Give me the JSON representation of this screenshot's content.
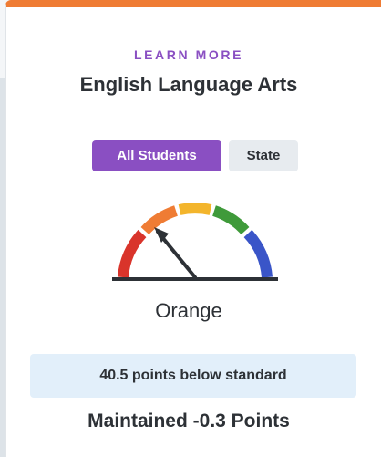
{
  "header": {
    "kicker": "LEARN MORE",
    "title": "English Language Arts"
  },
  "toggles": [
    {
      "label": "All Students",
      "selected": true
    },
    {
      "label": "State",
      "selected": false
    }
  ],
  "gauge": {
    "level": "Orange",
    "segments": [
      "Red",
      "Orange",
      "Yellow",
      "Green",
      "Blue"
    ],
    "colors": {
      "red": "#d9342b",
      "orange": "#ef7c34",
      "yellow": "#f3b52c",
      "green": "#3f9a3a",
      "blue": "#3a55c8"
    }
  },
  "status": "40.5 points below standard",
  "change": "Maintained -0.3 Points",
  "colors": {
    "accent": "#8a4fc2",
    "top_border": "#ef7c34",
    "status_bg": "#e2effa"
  }
}
